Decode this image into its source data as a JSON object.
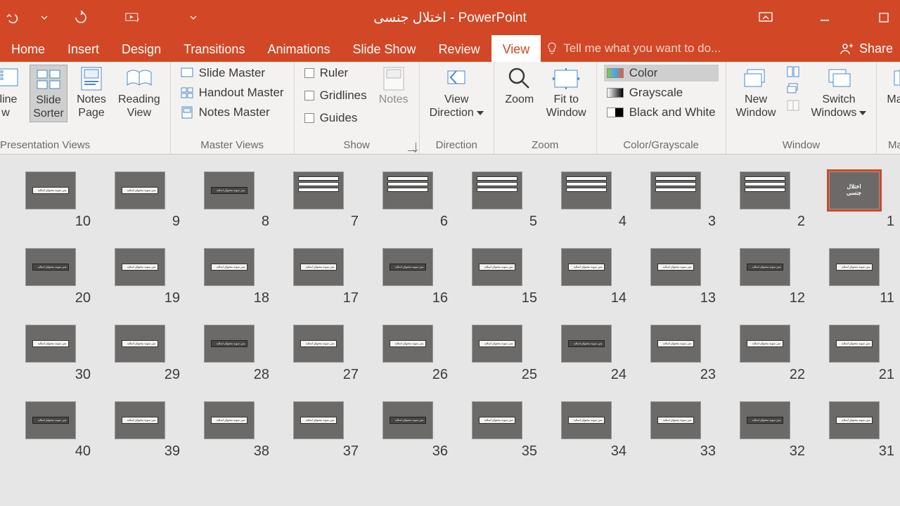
{
  "title": "اختلال جنسی - PowerPoint",
  "tabs": [
    "Home",
    "Insert",
    "Design",
    "Transitions",
    "Animations",
    "Slide Show",
    "Review",
    "View"
  ],
  "active_tab": "View",
  "tellme_placeholder": "Tell me what you want to do...",
  "share_label": "Share",
  "ribbon": {
    "presentation_views": {
      "label": "Presentation Views",
      "items": [
        {
          "l1": "cline",
          "l2": "w"
        },
        {
          "l1": "Slide",
          "l2": "Sorter"
        },
        {
          "l1": "Notes",
          "l2": "Page"
        },
        {
          "l1": "Reading",
          "l2": "View"
        }
      ]
    },
    "master_views": {
      "label": "Master Views",
      "items": [
        "Slide Master",
        "Handout Master",
        "Notes Master"
      ]
    },
    "show": {
      "label": "Show",
      "items": [
        "Ruler",
        "Gridlines",
        "Guides"
      ],
      "notes": "Notes"
    },
    "direction": {
      "label": "Direction",
      "item_l1": "View",
      "item_l2": "Direction"
    },
    "zoom": {
      "label": "Zoom",
      "zoom_l": "Zoom",
      "fit_l1": "Fit to",
      "fit_l2": "Window"
    },
    "colorgray": {
      "label": "Color/Grayscale",
      "items": [
        "Color",
        "Grayscale",
        "Black and White"
      ]
    },
    "window": {
      "label": "Window",
      "new_l1": "New",
      "new_l2": "Window",
      "switch_l1": "Switch",
      "switch_l2": "Windows"
    },
    "macros": {
      "label": "Macros",
      "btn": "Macros"
    }
  },
  "slides": {
    "selected": 1,
    "total_shown": 40,
    "title_text": "اختلال\nجنسی"
  },
  "chart_data": null
}
